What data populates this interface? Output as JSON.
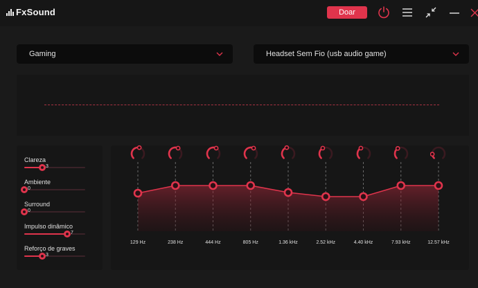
{
  "app": {
    "name": "FxSound"
  },
  "titlebar": {
    "donate_label": "Doar",
    "icons": [
      "power-icon",
      "menu-icon",
      "minimize-view-icon",
      "minimize-icon",
      "close-icon"
    ]
  },
  "colors": {
    "accent": "#e0344c",
    "background": "#1a1a1a",
    "panel": "#161616",
    "dropdown": "#0c0c0c"
  },
  "preset": {
    "selected": "Gaming"
  },
  "output_device": {
    "selected": "Headset Sem Fio (usb audio game)"
  },
  "effects": [
    {
      "name": "Clareza",
      "value": "3",
      "level": 0.3
    },
    {
      "name": "Ambiente",
      "value": "0",
      "level": 0
    },
    {
      "name": "Surround",
      "value": "0",
      "level": 0
    },
    {
      "name": "Impulso dinâmico",
      "value": "7",
      "level": 0.7
    },
    {
      "name": "Reforço de graves",
      "value": "3",
      "level": 0.3
    }
  ],
  "eq": {
    "bands": [
      {
        "label": "129 Hz",
        "level": 0.55,
        "knob": 0.55
      },
      {
        "label": "238 Hz",
        "level": 0.66,
        "knob": 0.6
      },
      {
        "label": "444 Hz",
        "level": 0.66,
        "knob": 0.6
      },
      {
        "label": "805 Hz",
        "level": 0.66,
        "knob": 0.6
      },
      {
        "label": "1.36 kHz",
        "level": 0.56,
        "knob": 0.45
      },
      {
        "label": "2.52 kHz",
        "level": 0.5,
        "knob": 0.4
      },
      {
        "label": "4.40 kHz",
        "level": 0.5,
        "knob": 0.4
      },
      {
        "label": "7.93 kHz",
        "level": 0.66,
        "knob": 0.38
      },
      {
        "label": "12.57 kHz",
        "level": 0.66,
        "knob": 0.15
      }
    ]
  }
}
